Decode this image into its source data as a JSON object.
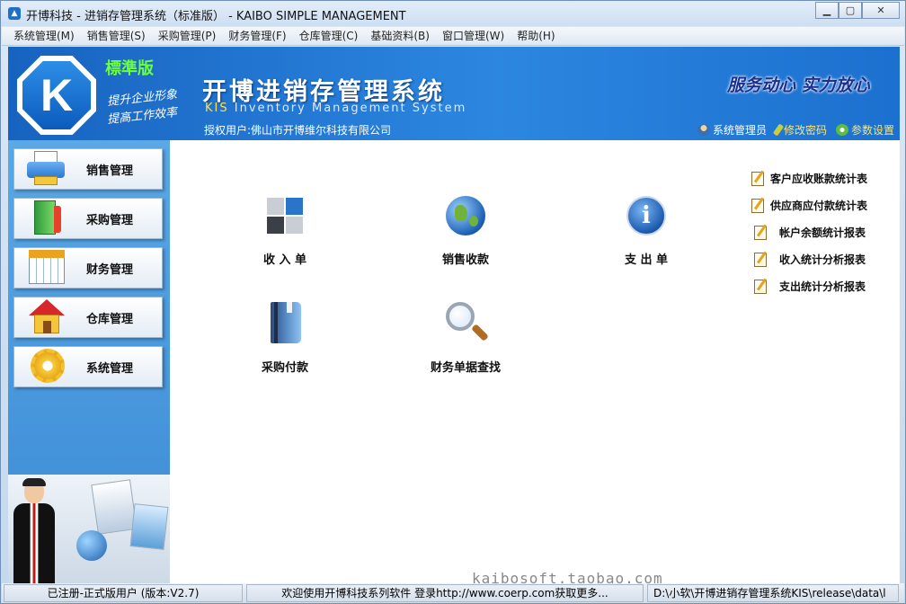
{
  "window": {
    "title": "开博科技 - 进销存管理系统（标准版） - KAIBO SIMPLE MANAGEMENT",
    "controls": {
      "minimize": "▁",
      "restore": "▢",
      "close": "✕"
    }
  },
  "menu": [
    "系统管理(M)",
    "销售管理(S)",
    "采购管理(P)",
    "财务管理(F)",
    "仓库管理(C)",
    "基础资料(B)",
    "窗口管理(W)",
    "帮助(H)"
  ],
  "header": {
    "logo_letter": "K",
    "edition": "標準版",
    "slogan_1": "提升企业形象",
    "slogan_2": "提高工作效率",
    "title": "开博进销存管理系统",
    "subtitle_prefix": "KIS",
    "subtitle_rest": " Inventory Management System",
    "license": "授权用户:佛山市开博维尔科技有限公司",
    "motto": "服务动心 实力放心",
    "links": {
      "user": "系统管理员",
      "change_password": "修改密码",
      "settings": "参数设置"
    }
  },
  "sidebar": {
    "items": [
      "销售管理",
      "采购管理",
      "财务管理",
      "仓库管理",
      "系统管理"
    ]
  },
  "modules": [
    "收 入 单",
    "销售收款",
    "支 出 单",
    "采购付款",
    "财务单据查找"
  ],
  "reports": [
    "客户应收账款统计表",
    "供应商应付款统计表",
    "帐户余额统计报表",
    "收入统计分析报表",
    "支出统计分析报表"
  ],
  "statusbar": {
    "registration": "已注册-正式版用户 (版本:V2.7)",
    "message": "欢迎使用开博科技系列软件    登录http://www.coerp.com获取更多...",
    "path": "D:\\小软\\开博进销存管理系统KIS\\release\\data\\l"
  },
  "watermark": "kaibosoft.taobao.com",
  "colors": {
    "header_blue": "#1c70cf",
    "sidebar_blue": "#3b8bd6",
    "edition_green": "#6dff3a",
    "motto_navy": "#1b2f8f"
  }
}
